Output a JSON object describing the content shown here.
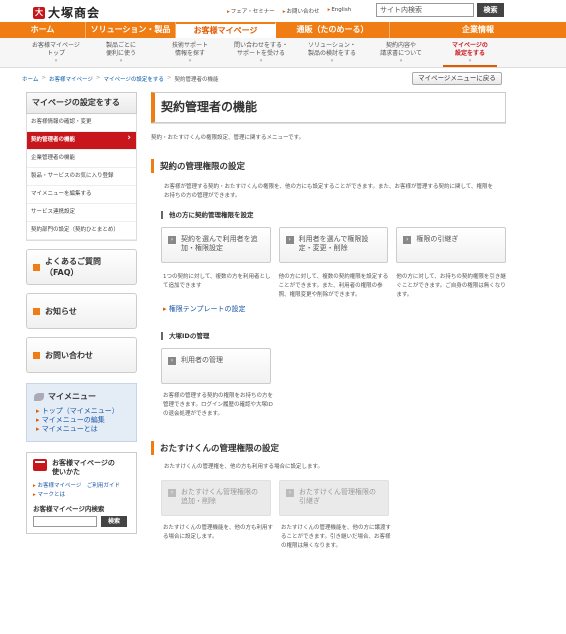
{
  "header": {
    "logo_mark": "大",
    "logo_text": "大塚商会",
    "utils": [
      "フェア・セミナー",
      "お問い合わせ",
      "English"
    ],
    "search_placeholder": "サイト内検索",
    "search_button": "検索"
  },
  "gnav": [
    "ホーム",
    "ソリューション・製品",
    "お客様マイページ",
    "通販（たのめーる）",
    "企業情報"
  ],
  "subnav": [
    "お客様マイページ\nトップ",
    "製品ごとに\n便利に使う",
    "技術サポート\n情報を探す",
    "問い合わせをする・\nサポートを受ける",
    "ソリューション・\n製品の検討をする",
    "契約内容や\n請求書について",
    "マイページの\n設定をする"
  ],
  "breadcrumb": [
    "ホーム",
    "お客様マイページ",
    "マイページの設定をする",
    "契約管理者の機能"
  ],
  "back_button": "マイページメニューに戻る",
  "sidebar": {
    "head": "マイページの設定をする",
    "items": [
      "お客様情報の確認・変更",
      "契約管理者の機能",
      "企業管理者の機能",
      "製品・サービスのお気に入り登録",
      "マイメニューを編集する",
      "サービス連携設定",
      "契約部門の設定（契約ひとまとめ）"
    ],
    "boxes": [
      "よくあるご質問\n（FAQ）",
      "お知らせ",
      "お問い合わせ"
    ],
    "mymenu": {
      "title": "マイメニュー",
      "links": [
        "トップ（マイメニュー）",
        "マイメニューの編集",
        "マイメニューとは"
      ]
    },
    "guide": {
      "title": "お客様マイページの\n使いかた",
      "links": [
        "お客様マイページ　ご利用ガイド",
        "マークとは"
      ],
      "search_label": "お客様マイページ内検索",
      "search_button": "検索"
    }
  },
  "main": {
    "title": "契約管理者の機能",
    "lead": "契約・おたすけくんの権限設定、管理に関するメニューです。",
    "section1": {
      "title": "契約の管理権限の設定",
      "text": "お客様が管理する契約・おたすけくんの権限を、他の方にも設定することができます。また、お客様が管理する契約に関して、権限をお持ちの方の管理ができます。",
      "sub1": "他の方に契約管理権限を設定",
      "cards": [
        "契約を選んで利用者を追加・権限設定",
        "利用者を選んで権限設定・変更・削除",
        "権限の引継ぎ"
      ],
      "descs": [
        "1つの契約に対して、複数の方を利用者として追加できます",
        "他の方に対して、複数の契約権限を設定することができます。また、利用者の権限の参照、権限変更や削除ができます。",
        "他の方に対して、お持ちの契約権限を引き継ぐことができます。ご自身の権限は無くなります。"
      ],
      "template_link": "権限テンプレートの設定",
      "sub2": "大塚IDの管理",
      "card2": "利用者の管理",
      "desc2": "お客様の管理する契約の権限をお持ちの方を管理できます。ログイン履歴の確認や大塚IDの退会処理ができます。"
    },
    "section2": {
      "title": "おたすけくんの管理権限の設定",
      "text": "おたすけくんの管理権を、他の方も利用する場合に設定します。",
      "cards": [
        "おたすけくん管理権限の追加・削除",
        "おたすけくん管理権限の引継ぎ"
      ],
      "descs": [
        "おたすけくんの管理機能を、他の方も利用する場合に設定します。",
        "おたすけくんの管理機能を、他の方に譲渡することができます。引き継いだ場合、お客様の権限は無くなります。"
      ]
    }
  }
}
